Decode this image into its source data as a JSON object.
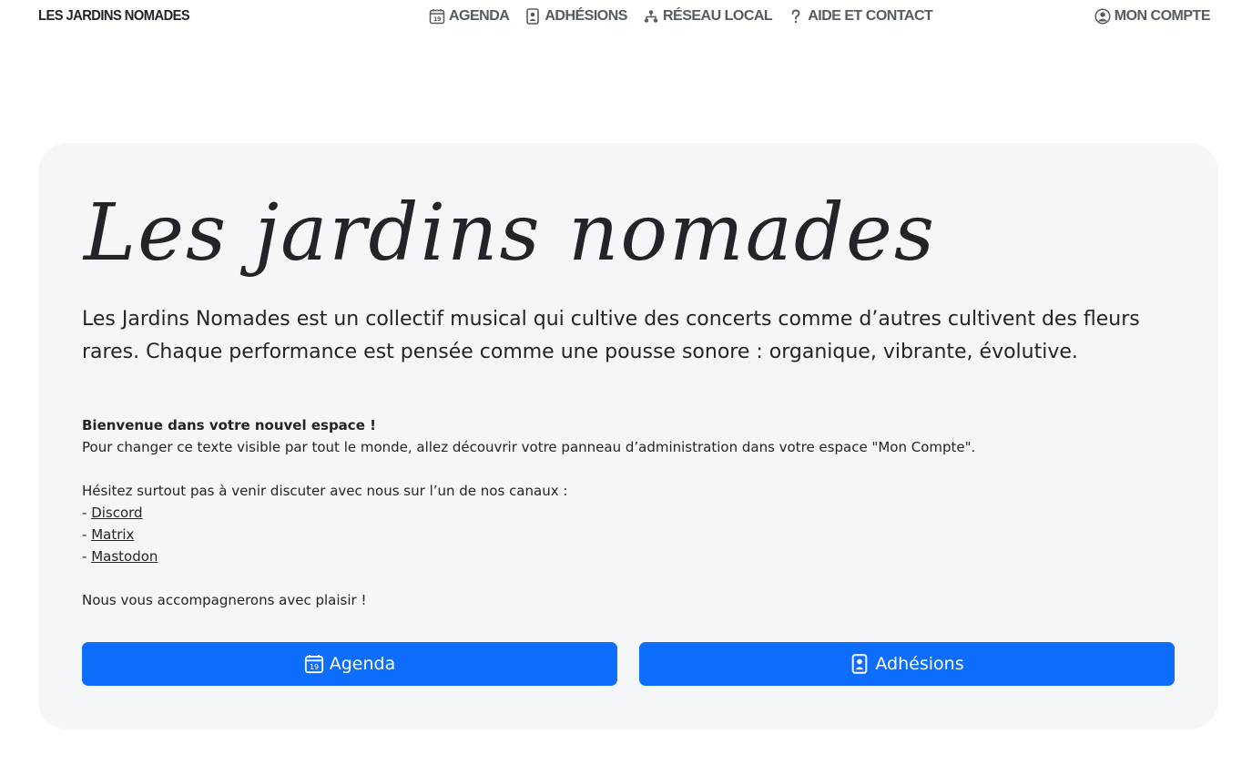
{
  "nav": {
    "brand": "LES JARDINS NOMADES",
    "links": [
      {
        "label": "AGENDA",
        "icon": "calendar-icon"
      },
      {
        "label": "ADHÉSIONS",
        "icon": "member-card-icon"
      },
      {
        "label": "RÉSEAU LOCAL",
        "icon": "network-icon"
      },
      {
        "label": "AIDE ET CONTACT",
        "icon": "question-icon"
      }
    ],
    "account": {
      "label": "MON COMPTE",
      "icon": "user-circle-icon"
    },
    "calendar_day": "19"
  },
  "hero": {
    "title": "Les jardins nomades",
    "lead": "Les Jardins Nomades est un collectif musical qui cultive des concerts comme d’autres cultivent des fleurs rares. Chaque performance est pensée comme une pousse sonore : organique, vibrante, évolutive.",
    "welcome": "Bienvenue dans votre nouvel espace !",
    "admin_text": "Pour changer ce texte visible par tout le monde, allez découvrir votre panneau d’administration dans votre espace \"Mon Compte\".",
    "channels_intro": "Hésitez surtout pas à venir discuter avec nous sur l’un de nos canaux :",
    "bullet": "- ",
    "channels": [
      "Discord",
      "Matrix",
      "Mastodon"
    ],
    "closing": "Nous vous accompagnerons avec plaisir !"
  },
  "buttons": {
    "agenda": "Agenda",
    "adhesions": "Adhésions"
  },
  "colors": {
    "primary": "#0d6efd",
    "hero_bg": "#f5f6f8",
    "nav_text": "#555b61"
  }
}
